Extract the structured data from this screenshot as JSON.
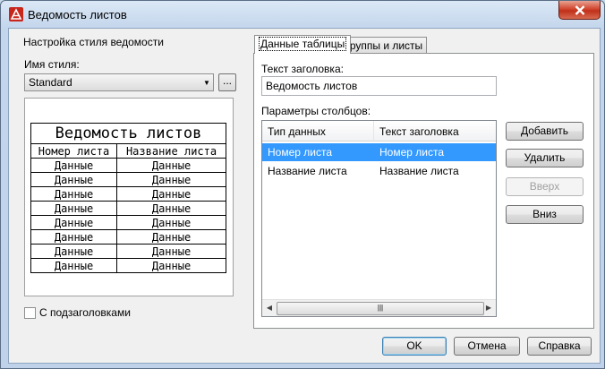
{
  "window": {
    "title": "Ведомость листов"
  },
  "left": {
    "group_title": "Настройка стиля ведомости",
    "style_label": "Имя стиля:",
    "style_value": "Standard",
    "ellipsis": "...",
    "preview": {
      "title": "Ведомость листов",
      "headers": [
        "Номер листа",
        "Название листа"
      ],
      "row_text": [
        "Данные",
        "Данные"
      ],
      "row_count": 8
    },
    "subheaders_label": "С подзаголовками"
  },
  "tabs": [
    {
      "label": "Данные таблицы",
      "active": true
    },
    {
      "label": "Группы и листы",
      "active": false
    }
  ],
  "table_data": {
    "header_text_label": "Текст заголовка:",
    "header_text_value": "Ведомость листов",
    "columns_label": "Параметры столбцов:",
    "columns": [
      "Тип данных",
      "Текст заголовка"
    ],
    "rows": [
      [
        "Номер листа",
        "Номер листа"
      ],
      [
        "Название листа",
        "Название листа"
      ]
    ],
    "selected_row": 0
  },
  "buttons": {
    "add": "Добавить",
    "remove": "Удалить",
    "up": "Вверх",
    "down": "Вниз",
    "ok": "OK",
    "cancel": "Отмена",
    "help": "Справка"
  },
  "colors": {
    "selection": "#3399ff",
    "close_button": "#c94430"
  }
}
